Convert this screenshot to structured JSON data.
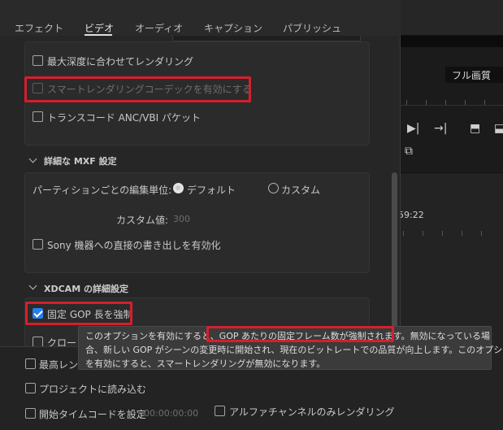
{
  "tabs": [
    "エフェクト",
    "ビデオ",
    "オーディオ",
    "キャプション",
    "パブリッシュ"
  ],
  "active_tab": "ビデオ",
  "render_options": {
    "max_depth": "最大深度に合わせてレンダリング",
    "smart_render_codec": "スマートレンダリングコーデックを有効にする",
    "transcode": "トランスコード ANC/VBI パケット"
  },
  "mxf": {
    "title": "詳細な MXF 設定",
    "partition_label": "パーティションごとの編集単位:",
    "default_option": "デフォルト",
    "custom_option": "カスタム",
    "custom_value_label": "カスタム値:",
    "custom_value": "300",
    "sony_direct_write": "Sony 機器への直接の書き出しを有効化"
  },
  "xdcam": {
    "title": "XDCAM の詳細設定",
    "fixed_gop": "固定 GOP 長を強制",
    "closed_gop_partial": "クロー"
  },
  "lower": {
    "max_render_partial": "最高レン",
    "import_project": "プロジェクトに読み込む",
    "start_timecode": "開始タイムコードを設定",
    "start_timecode_value": "00:00:00:00",
    "alpha_only": "アルファチャンネルのみレンダリング"
  },
  "tooltip": {
    "line1_pre": "このオプションを有効にすると、",
    "line1_highlight": "GOP あたりの固定フレーム数が強制されます。",
    "line1_post": "無効になっている場",
    "line2": "合、新しい GOP がシーンの変更時に開始され、現在のビットレートでの品質が向上します。このオプション",
    "line3": "を有効にすると、スマートレンダリングが無効になります。"
  },
  "background": {
    "quality_dropdown": "フル画質",
    "timecode": "59:22"
  },
  "colors": {
    "highlight_red": "#d4202c",
    "checkbox_blue": "#2680eb"
  }
}
